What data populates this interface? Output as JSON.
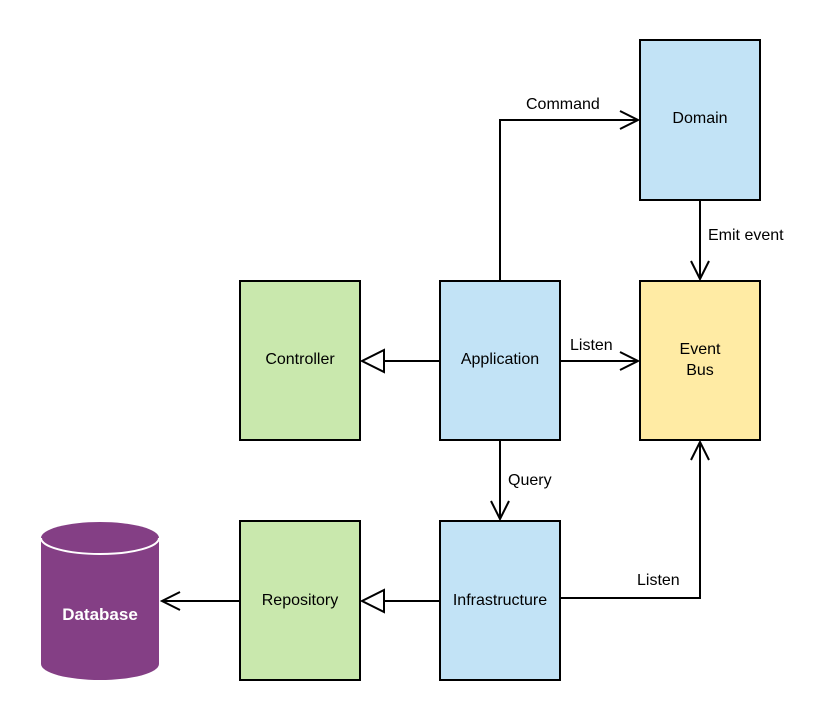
{
  "colors": {
    "domain_layer": "#c2e3f6",
    "interface_layer": "#c9e8ad",
    "event_bus": "#ffeba4",
    "database": "#843f85"
  },
  "nodes": {
    "domain": "Domain",
    "controller": "Controller",
    "application": "Application",
    "event_bus_line1": "Event",
    "event_bus_line2": "Bus",
    "repository": "Repository",
    "infrastructure": "Infrastructure",
    "database": "Database"
  },
  "edges": {
    "command": "Command",
    "emit_event": "Emit event",
    "listen_app": "Listen",
    "query": "Query",
    "listen_infra": "Listen"
  }
}
